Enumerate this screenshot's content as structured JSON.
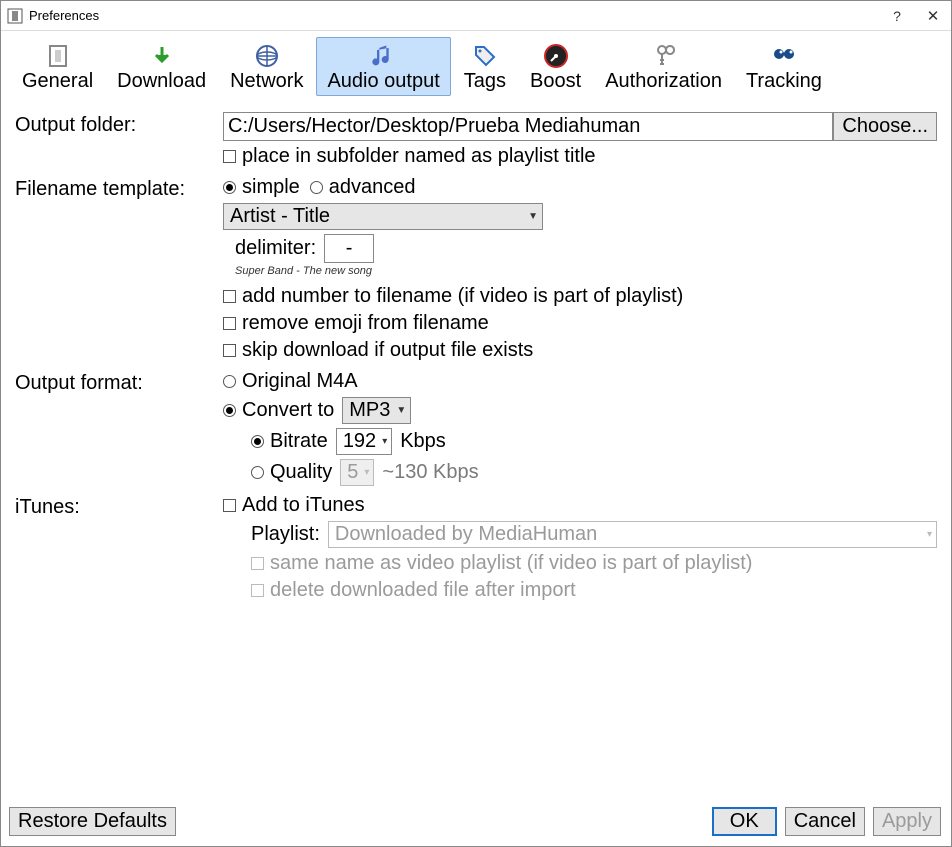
{
  "window": {
    "title": "Preferences"
  },
  "tabs": {
    "general": "General",
    "download": "Download",
    "network": "Network",
    "audio_output": "Audio output",
    "tags": "Tags",
    "boost": "Boost",
    "authorization": "Authorization",
    "tracking": "Tracking"
  },
  "output_folder": {
    "label": "Output folder:",
    "value": "C:/Users/Hector/Desktop/Prueba Mediahuman",
    "choose_btn": "Choose...",
    "subfolder_check": "place in subfolder named as playlist title"
  },
  "filename_template": {
    "label": "Filename template:",
    "simple": "simple",
    "advanced": "advanced",
    "template_combo": "Artist - Title",
    "delimiter_label": "delimiter:",
    "delimiter_value": "-",
    "example": "Super Band - The new song",
    "add_number": "add number to filename (if video is part of playlist)",
    "remove_emoji": "remove emoji from filename",
    "skip_download": "skip download if output file exists"
  },
  "output_format": {
    "label": "Output format:",
    "original": "Original M4A",
    "convert_to": "Convert to",
    "format_combo": "MP3",
    "bitrate_label": "Bitrate",
    "bitrate_value": "192",
    "bitrate_unit": "Kbps",
    "quality_label": "Quality",
    "quality_value": "5",
    "quality_hint": "~130 Kbps"
  },
  "itunes": {
    "label": "iTunes:",
    "add_check": "Add to iTunes",
    "playlist_label": "Playlist:",
    "playlist_value": "Downloaded by MediaHuman",
    "same_name": "same name as video playlist (if video is part of playlist)",
    "delete_after": "delete downloaded file after import"
  },
  "footer": {
    "restore": "Restore Defaults",
    "ok": "OK",
    "cancel": "Cancel",
    "apply": "Apply"
  }
}
